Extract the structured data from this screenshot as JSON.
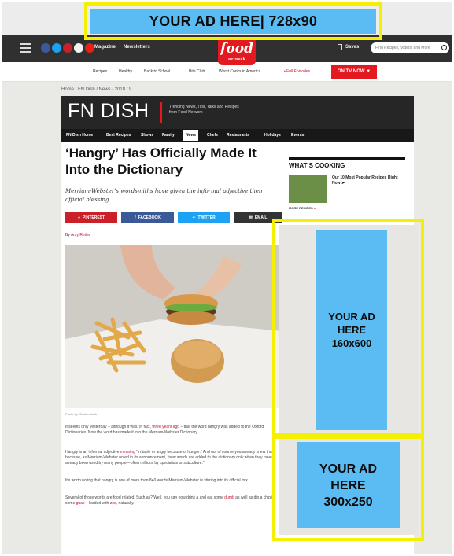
{
  "ads": {
    "top": "YOUR AD HERE| 728x90",
    "side_line1": "YOUR AD",
    "side_line2": "HERE",
    "side_line3": "160x600",
    "rect_line1": "YOUR AD",
    "rect_line2": "HERE",
    "rect_line3": "300x250"
  },
  "navbar": {
    "magazine": "Magazine",
    "newsletters": "Newsletters",
    "logo": "food",
    "logo_sub": "network",
    "saves": "Saves",
    "search_placeholder": "Find Recipes, Videos and More"
  },
  "subnav": {
    "items": [
      "Recipes",
      "Healthy",
      "Back to School",
      "Bite Club",
      "Worst Cooks in America",
      "• Full Episodes"
    ],
    "on_tv_now": "ON TV NOW"
  },
  "breadcrumb": "Home / FN Dish / News / 2018 / 9",
  "fndish": {
    "logo": "FN DISH",
    "tagline_1": "Trending News, Tips, Talks and Recipes",
    "tagline_2": "from Food Network",
    "tabs": [
      "FN Dish Home",
      "Best Recipes",
      "Shows",
      "Family",
      "News",
      "Chefs",
      "Restaurants",
      "Holidays",
      "Events"
    ]
  },
  "article": {
    "headline": "‘Hangry’ Has Officially Made It Into the Dictionary",
    "dek": "Merriam-Webster’s wordsmiths have given the informal adjective their official blessing.",
    "share": [
      "PINTEREST",
      "FACEBOOK",
      "TWITTER",
      "EMAIL"
    ],
    "byline_prefix": "By",
    "byline_author": "Amy Reiter",
    "caption": "Photo by: Shutterstock",
    "para1_a": "It seems only yesterday – although it was, in fact,",
    "para1_link": "three years ago",
    "para1_b": "– that the word hangry was added to the Oxford Dictionaries. Now the word has made it into the Merriam-Webster Dictionary.",
    "para2_a": "Hangry is an informal adjective",
    "para2_link": "meaning",
    "para2_b": "“irritable or angry because of hunger.” And out of course you already knew that because, as Merriam-Webster noted in its announcement, “new words are added to the dictionary only when they have already been used by many people—often millions by specialists or subculture.”",
    "para3": "It’s worth noting that hangry is one of more than 840 words Merriam-Webster is stirring into its official mix.",
    "para4_a": "Several of those words are food related. Such as? Well, you can now drink a",
    "para4_link1": "",
    "para4_b": "and eat some",
    "para4_link2": "dumb",
    "para4_c": "as well as dip a chip in some",
    "para4_link3": "guac",
    "para4_d": "– loaded with",
    "para4_link4": "zoo",
    "para4_e": ", naturally."
  },
  "sidebar": {
    "whats_cooking": "WHAT’S COOKING",
    "promo": "Our 10 Most Popular Recipes Right Now",
    "more": "MORE RECIPES"
  },
  "colors": {
    "ad_fill": "#5bbcf3",
    "ad_border": "#f5ef00",
    "brand_red": "#e3191f",
    "nav_dark": "#303030"
  }
}
